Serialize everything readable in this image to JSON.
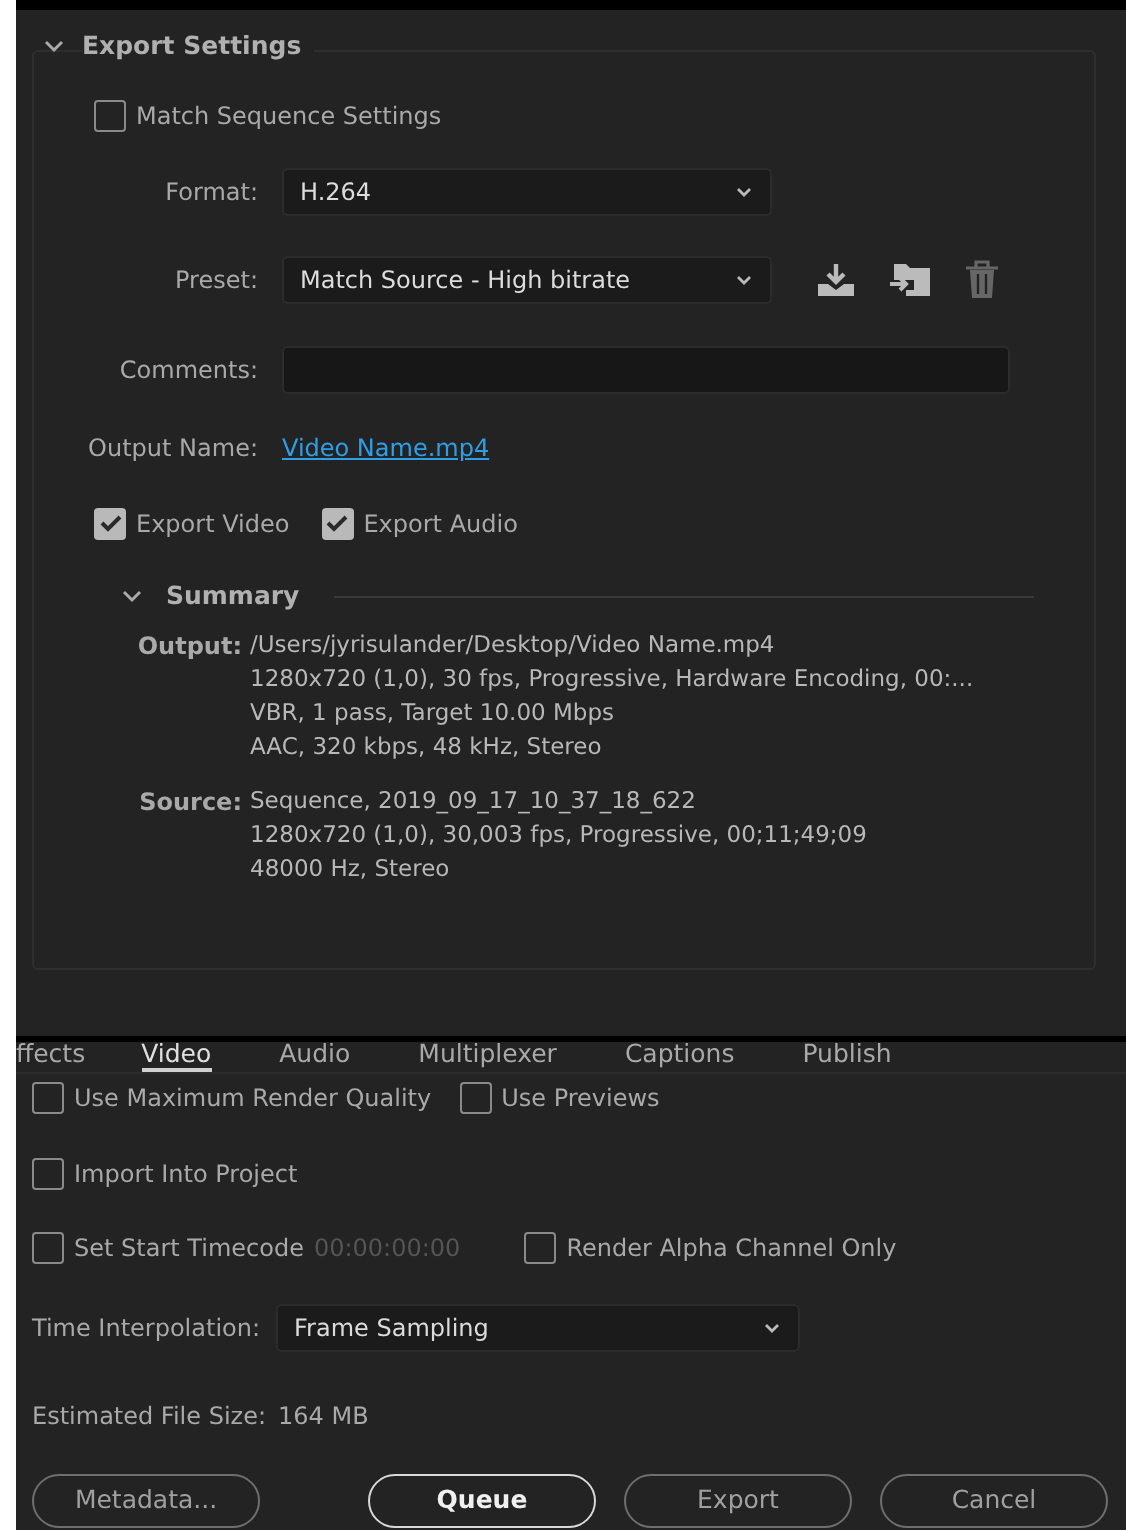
{
  "export_settings": {
    "title": "Export Settings",
    "expanded": true,
    "match_sequence": {
      "label": "Match Sequence Settings",
      "checked": false
    },
    "format": {
      "label": "Format:",
      "value": "H.264"
    },
    "preset": {
      "label": "Preset:",
      "value": "Match Source - High bitrate"
    },
    "comments": {
      "label": "Comments:"
    },
    "output_name": {
      "label": "Output Name:",
      "value": "Video Name.mp4"
    },
    "export_checks": [
      {
        "label": "Export Video",
        "checked": true
      },
      {
        "label": "Export Audio",
        "checked": true
      }
    ],
    "summary": {
      "title": "Summary",
      "expanded": true,
      "entries": [
        {
          "label": "Output:",
          "lines": [
            "/Users/jyrisulander/Desktop/Video Name.mp4",
            "1280x720 (1,0), 30 fps, Progressive, Hardware Encoding, 00:...",
            "VBR, 1 pass, Target 10.00 Mbps",
            "AAC, 320 kbps, 48 kHz, Stereo"
          ]
        },
        {
          "label": "Source:",
          "lines": [
            "Sequence, 2019_09_17_10_37_18_622",
            "1280x720 (1,0), 30,003 fps, Progressive, 00;11;49;09",
            "48000 Hz, Stereo"
          ]
        }
      ]
    }
  },
  "tabs": [
    {
      "label": "ffects",
      "selected": false
    },
    {
      "label": "Video",
      "selected": true
    },
    {
      "label": "Audio",
      "selected": false
    },
    {
      "label": "Multiplexer",
      "selected": false
    },
    {
      "label": "Captions",
      "selected": false
    },
    {
      "label": "Publish",
      "selected": false
    }
  ],
  "render_checks": [
    {
      "label": "Use Maximum Render Quality",
      "checked": false
    },
    {
      "label": "Use Previews",
      "checked": false
    }
  ],
  "import_into_project": {
    "label": "Import Into Project",
    "checked": false
  },
  "start_timecode": {
    "label": "Set Start Timecode",
    "checked": false,
    "value": "00:00:00:00"
  },
  "alpha_only": {
    "label": "Render Alpha Channel Only",
    "checked": false
  },
  "time_interpolation": {
    "label": "Time Interpolation:",
    "value": "Frame Sampling"
  },
  "file_size": {
    "label": "Estimated File Size:",
    "value": "164 MB"
  },
  "buttons": [
    {
      "label": "Metadata...",
      "primary": false
    },
    {
      "label": "Queue",
      "primary": true
    },
    {
      "label": "Export",
      "primary": false
    },
    {
      "label": "Cancel",
      "primary": false
    }
  ]
}
